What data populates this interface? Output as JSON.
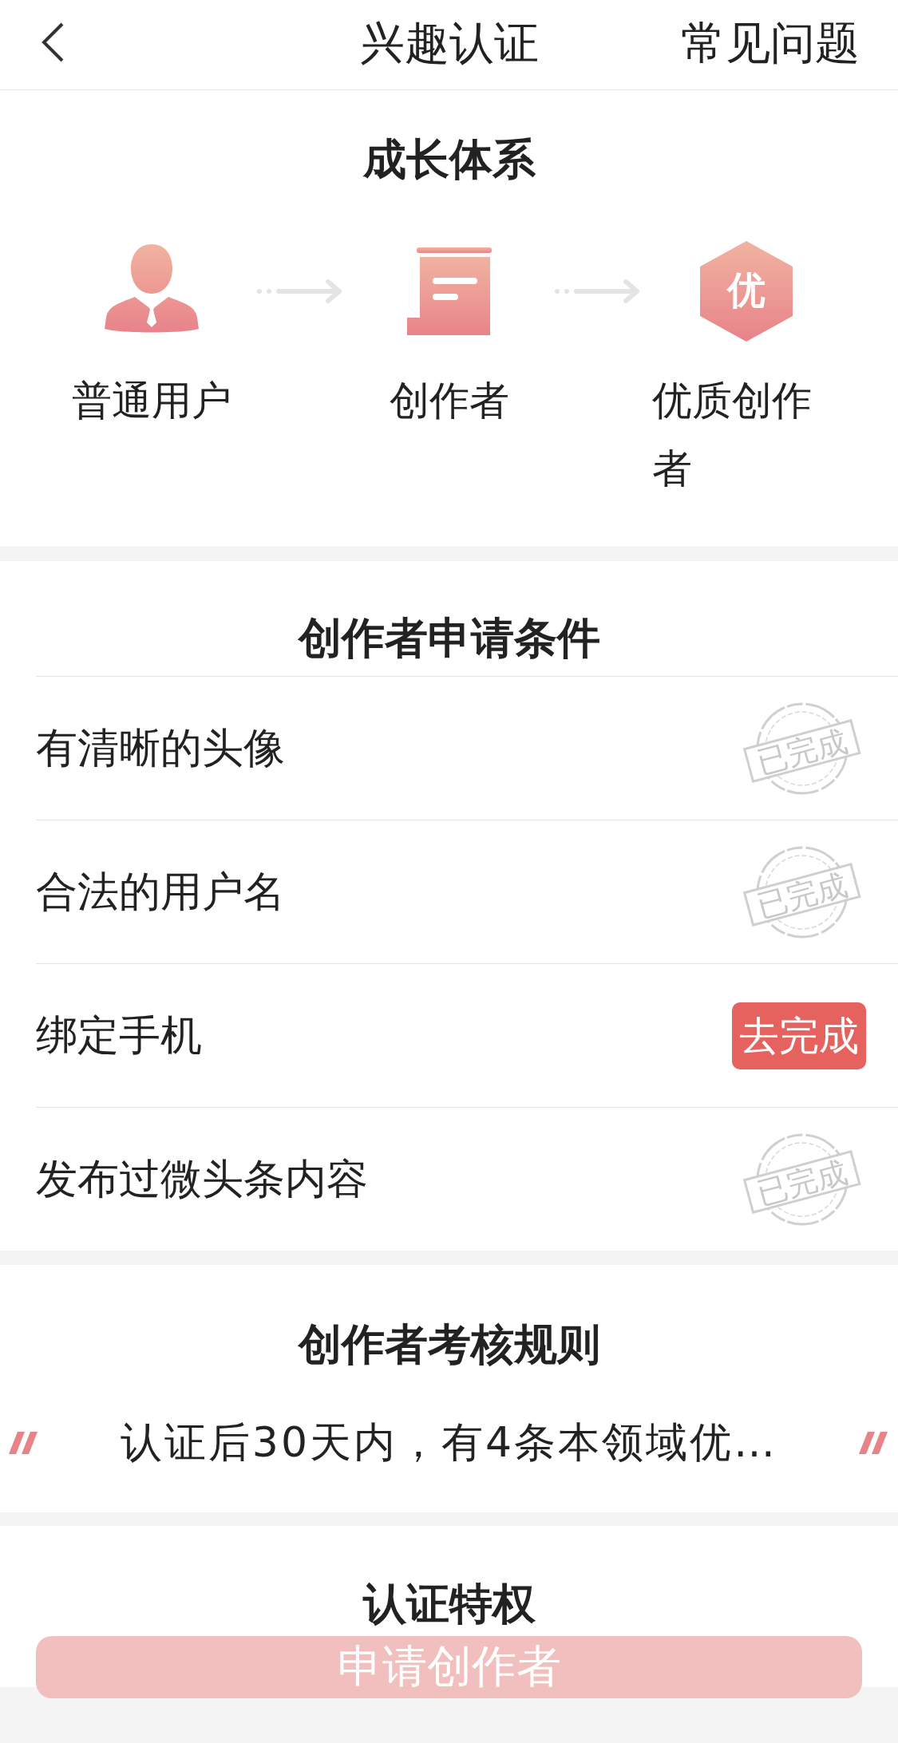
{
  "header": {
    "title": "兴趣认证",
    "faq_link": "常见问题"
  },
  "growth": {
    "title": "成长体系",
    "stages": [
      {
        "kind": "user",
        "label": "普通用户"
      },
      {
        "kind": "document",
        "label": "创作者"
      },
      {
        "kind": "hexagon",
        "icon_text": "优",
        "label": "优质创作者"
      }
    ]
  },
  "conditions": {
    "title": "创作者申请条件",
    "items": [
      {
        "label": "有清晰的头像",
        "done": true,
        "status": "已完成"
      },
      {
        "label": "合法的用户名",
        "done": true,
        "status": "已完成"
      },
      {
        "label": "绑定手机",
        "done": false,
        "status": "去完成"
      },
      {
        "label": "发布过微头条内容",
        "done": true,
        "status": "已完成"
      }
    ]
  },
  "rules": {
    "title": "创作者考核规则",
    "text": "认证后30天内，有4条本领域优…"
  },
  "privileges": {
    "title": "认证特权"
  },
  "apply_button": {
    "label": "申请创作者",
    "disabled": true
  }
}
